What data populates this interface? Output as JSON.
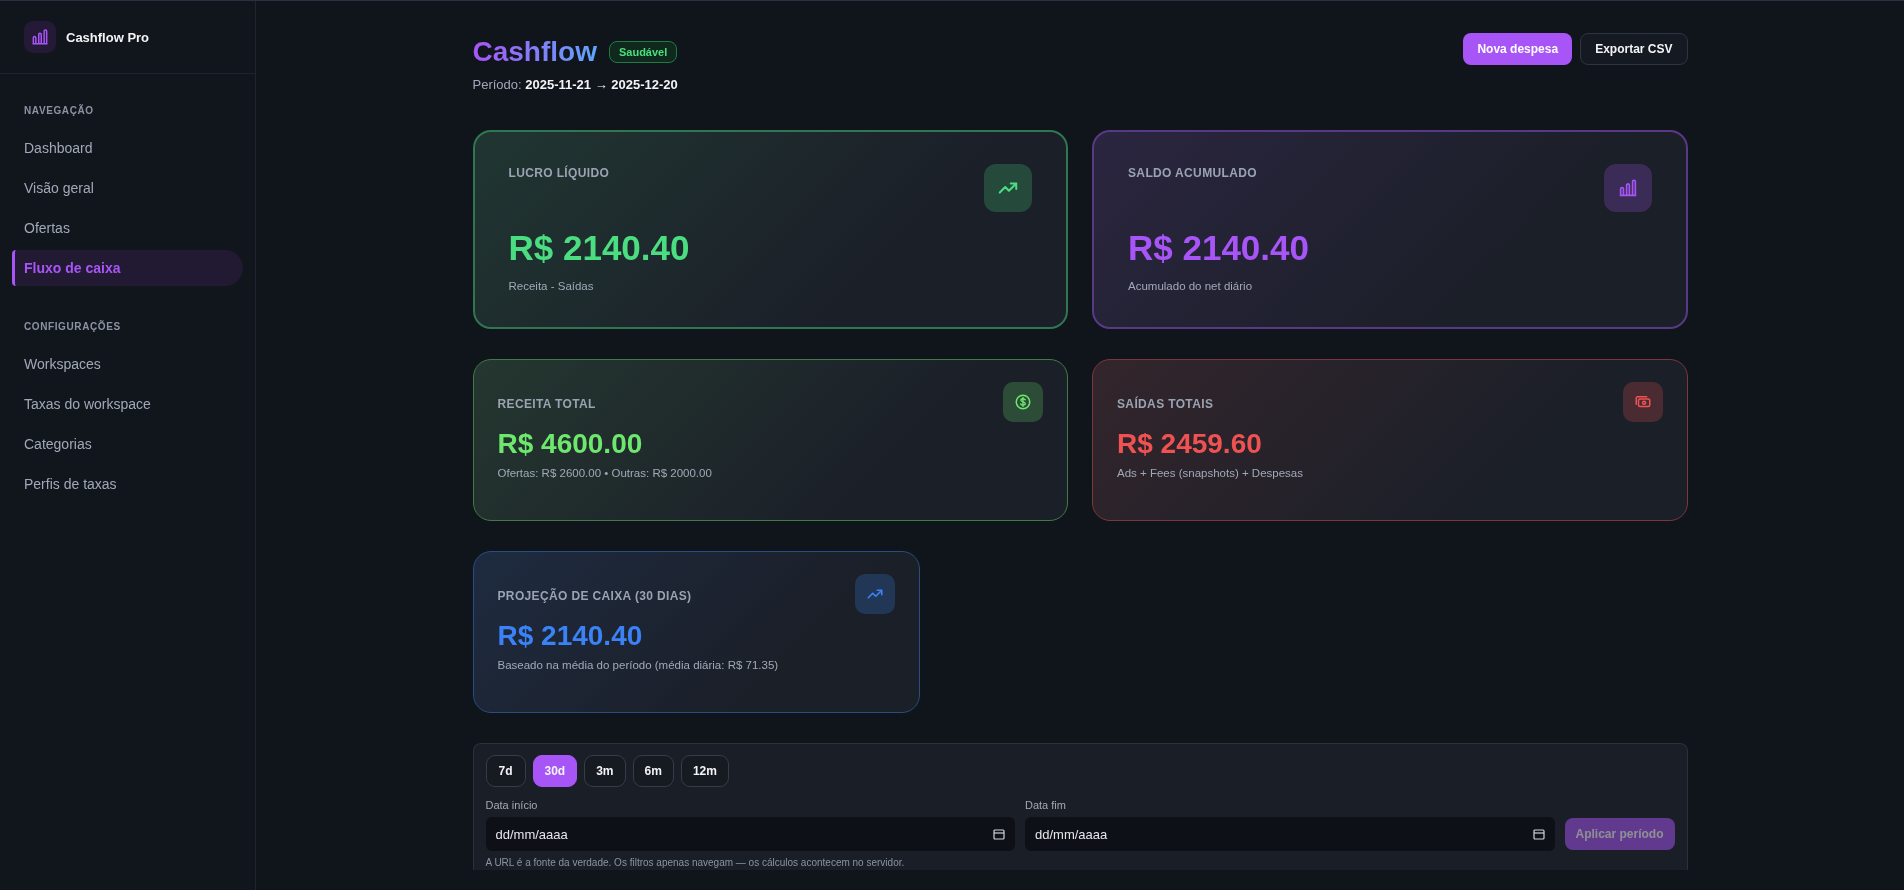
{
  "sidebar": {
    "brand": "Cashflow Pro",
    "sections": [
      {
        "heading": "NAVEGAÇÃO",
        "items": [
          {
            "label": "Dashboard",
            "selected": false
          },
          {
            "label": "Visão geral",
            "selected": false
          },
          {
            "label": "Ofertas",
            "selected": false
          },
          {
            "label": "Fluxo de caixa",
            "selected": true
          }
        ]
      },
      {
        "heading": "CONFIGURAÇÕES",
        "items": [
          {
            "label": "Workspaces",
            "selected": false
          },
          {
            "label": "Taxas do workspace",
            "selected": false
          },
          {
            "label": "Categorias",
            "selected": false
          },
          {
            "label": "Perfis de taxas",
            "selected": false
          }
        ]
      }
    ]
  },
  "header": {
    "title": "Cashflow",
    "status_badge": "Saudável",
    "period_label": "Período:",
    "period_value": "2025-11-21 → 2025-12-20",
    "buttons": [
      {
        "label": "Nova despesa",
        "kind": "primary"
      },
      {
        "label": "Exportar CSV",
        "kind": "secondary"
      }
    ]
  },
  "card_rows": [
    {
      "cards": [
        {
          "kind": "hero",
          "color": "#4ade80",
          "label": "LUCRO LÍQUIDO",
          "value": "R$ 2140.40",
          "note": "Receita - Saídas"
        },
        {
          "kind": "hero",
          "color": "#a855f7",
          "label": "SALDO ACUMULADO",
          "value": "R$ 2140.40",
          "note": "Acumulado do net diário"
        }
      ]
    },
    {
      "cards": [
        {
          "kind": "standard",
          "color": "#6ee76e",
          "label": "RECEITA TOTAL",
          "value": "R$ 4600.00",
          "note": "Ofertas: R$ 2600.00 • Outras: R$ 2000.00"
        },
        {
          "kind": "standard",
          "color": "#f05252",
          "label": "SAÍDAS TOTAIS",
          "value": "R$ 2459.60",
          "note": "Ads + Fees (snapshots) + Despesas"
        }
      ]
    },
    {
      "cards": [
        {
          "kind": "narrow",
          "color": "#3b82f6",
          "label": "PROJEÇÃO DE CAIXA (30 DIAS)",
          "value": "R$ 2140.40",
          "note": "Baseado na média do período (média diária: R$ 71.35)"
        }
      ]
    }
  ],
  "filters": {
    "presets": [
      {
        "label": "7d",
        "selected": false
      },
      {
        "label": "30d",
        "selected": true
      },
      {
        "label": "3m",
        "selected": false
      },
      {
        "label": "6m",
        "selected": false
      },
      {
        "label": "12m",
        "selected": false
      }
    ],
    "fields": [
      {
        "label": "Data início",
        "placeholder": "dd/mm/aaaa"
      },
      {
        "label": "Data fim",
        "placeholder": "dd/mm/aaaa"
      }
    ],
    "apply_button": {
      "label": "Aplicar período",
      "disabled": true
    },
    "footnote": "A URL é a fonte da verdade. Os filtros apenas navegam — os cálculos acontecem no servidor."
  }
}
